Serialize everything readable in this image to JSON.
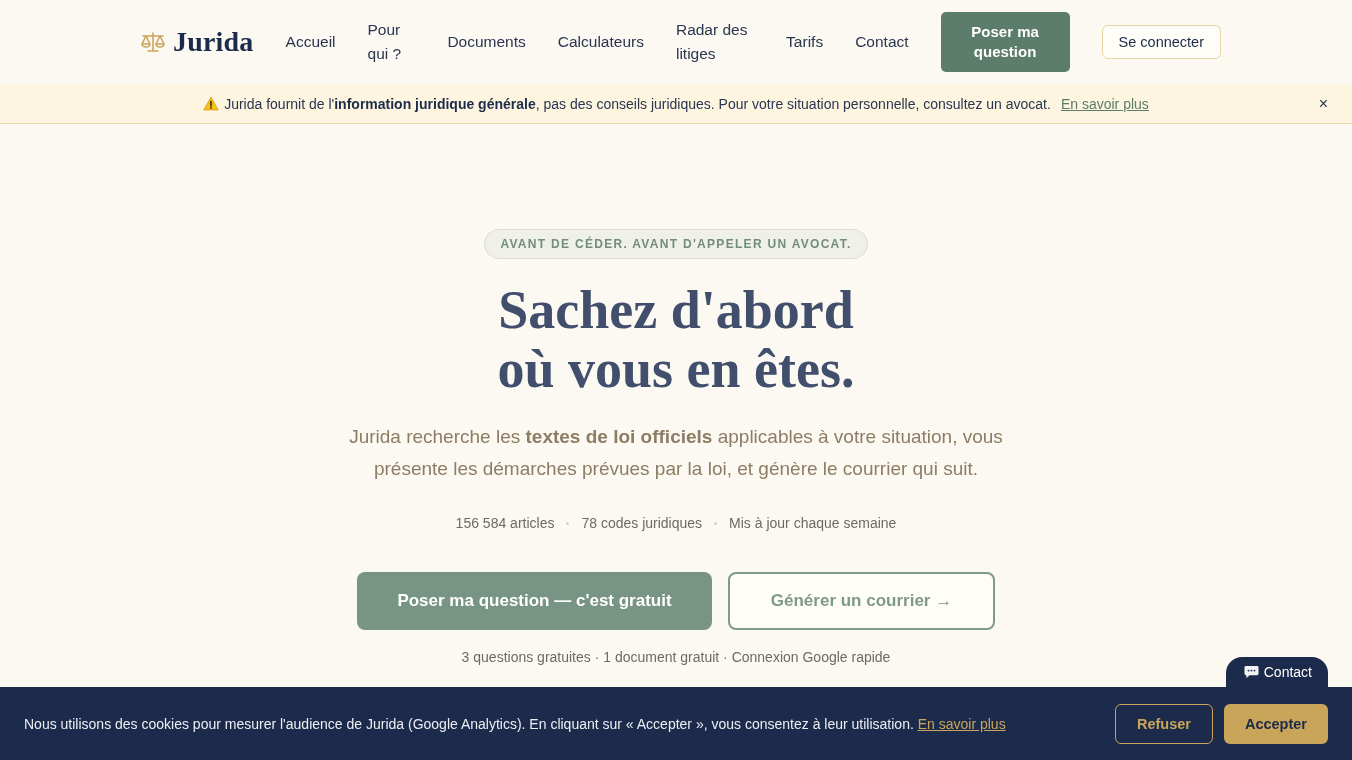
{
  "header": {
    "logo": "Jurida",
    "nav": [
      "Accueil",
      "Pour qui ?",
      "Documents",
      "Calculateurs",
      "Radar des litiges",
      "Tarifs",
      "Contact"
    ],
    "cta": "Poser ma question",
    "login": "Se connecter"
  },
  "notice": {
    "text": "Jurida fournit de l'**information juridique générale**, pas des conseils juridiques. Pour votre situation personnelle, consultez un avocat.",
    "link": "En savoir plus",
    "close": "×"
  },
  "hero": {
    "eyebrow": "AVANT DE CÉDER. AVANT D'APPELER UN AVOCAT.",
    "title_lines": [
      "Sachez d'abord",
      "où vous en êtes."
    ],
    "subtitle": "Jurida recherche les **textes de loi officiels** applicables à votre situation, vous présente les démarches prévues par la loi, et génère le courrier qui suit.",
    "stats": [
      "156 584 articles",
      "78 codes juridiques",
      "Mis à jour chaque semaine"
    ],
    "buttons": [
      {
        "label": "Poser ma question — c'est gratuit",
        "kind": "filled"
      },
      {
        "label": "Générer un courrier →",
        "kind": "outline"
      }
    ],
    "note": "3 questions gratuites · 1 document gratuit · Connexion Google rapide"
  },
  "contact_button": "Contact",
  "cookie_banner": {
    "text": "Nous utilisons des cookies pour mesurer l'audience de Jurida (Google Analytics). En cliquant sur « Accepter », vous consentez à leur utilisation.",
    "link": "En savoir plus",
    "buttons": [
      {
        "label": "Refuser",
        "kind": "outline"
      },
      {
        "label": "Accepter",
        "kind": "filled"
      }
    ]
  }
}
